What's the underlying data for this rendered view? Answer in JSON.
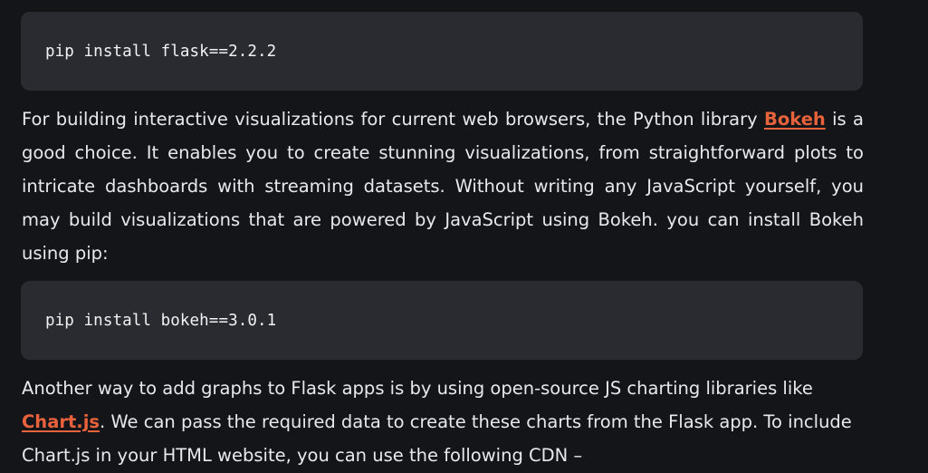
{
  "code_blocks": [
    {
      "command": "pip install flask==2.2.2"
    },
    {
      "command": "pip install bokeh==3.0.1"
    }
  ],
  "paragraph1": {
    "line1_before": "For building interactive visualizations for current web browsers, the Python library ",
    "line1_link": "Bokeh",
    "line1_after": " is a",
    "line2": "good choice. It enables you to create stunning visualizations, from straightforward plots to",
    "line3": "intricate dashboards with streaming datasets. Without writing any JavaScript yourself, you",
    "line4": "may build visualizations that are powered by JavaScript using Bokeh. you can install Bokeh",
    "line5": "using pip:"
  },
  "paragraph2": {
    "line1": "Another way to add graphs to Flask apps is by using open-source JS charting libraries like",
    "line2_link": "Chart.js",
    "line2_after": ". We can pass the required data to create these charts from the Flask app. To include",
    "line3": "Chart.js in your HTML website, you can use the following CDN –"
  },
  "colors": {
    "background": "#141519",
    "code_background": "#2a2b31",
    "link": "#e8623c",
    "text": "#e9e9ec"
  }
}
